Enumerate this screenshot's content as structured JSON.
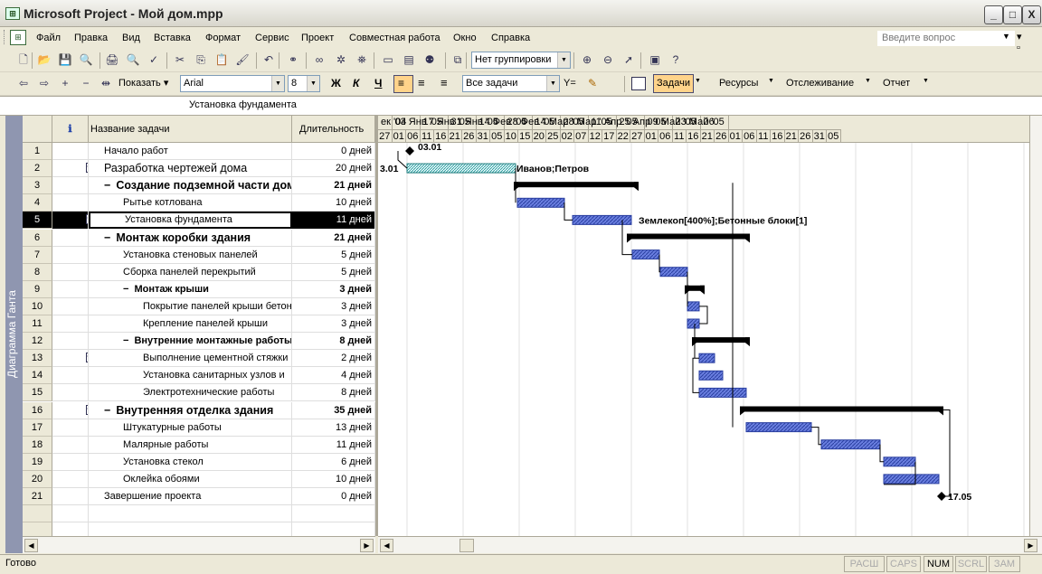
{
  "window": {
    "title": "Microsoft Project - Мой дом.mpp",
    "app_icon": "project-icon",
    "min_label": "_",
    "max_label": "□",
    "close_label": "X"
  },
  "menubar": {
    "items": [
      "Файл",
      "Правка",
      "Вид",
      "Вставка",
      "Формат",
      "Сервис",
      "Проект",
      "Совместная работа",
      "Окно",
      "Справка"
    ],
    "help_placeholder": "Введите вопрос",
    "doc_controls": "▾ ▫ ×"
  },
  "toolbar_standard": {
    "grouping_value": "Нет группировки"
  },
  "toolbar_formatting": {
    "show_label": "Показать",
    "font_value": "Arial",
    "size_value": "8",
    "bold_label": "Ж",
    "italic_label": "К",
    "underline_label": "Ч",
    "filter_value": "Все задачи",
    "tasks_label": "Задачи",
    "resources_label": "Ресурсы",
    "tracking_label": "Отслеживание",
    "report_label": "Отчет"
  },
  "entry_bar": {
    "value": "Установка фундамента"
  },
  "view_bar": {
    "label": "Диаграмма Ганта"
  },
  "table": {
    "headers": {
      "info": "ℹ",
      "name": "Название задачи",
      "duration": "Длительность"
    },
    "rows": [
      {
        "id": "1",
        "name": "Начало работ",
        "duration": "0 дней",
        "level": 0,
        "summary": false,
        "indicator": false
      },
      {
        "id": "2",
        "name": "Разработка чертежей дома",
        "duration": "20 дней",
        "level": 0,
        "summary": false,
        "indicator": true,
        "big": true
      },
      {
        "id": "3",
        "name": "Создание подземной части дом",
        "duration": "21 дней",
        "level": 0,
        "summary": true,
        "indicator": false
      },
      {
        "id": "4",
        "name": "Рытье котлована",
        "duration": "10 дней",
        "level": 1,
        "summary": false,
        "indicator": false
      },
      {
        "id": "5",
        "name": "Установка фундамента",
        "duration": "11 дней",
        "level": 1,
        "summary": false,
        "indicator": true,
        "selected": true
      },
      {
        "id": "6",
        "name": "Монтаж коробки здания",
        "duration": "21 дней",
        "level": 0,
        "summary": true,
        "indicator": false
      },
      {
        "id": "7",
        "name": "Установка стеновых панелей",
        "duration": "5 дней",
        "level": 1,
        "summary": false,
        "indicator": false
      },
      {
        "id": "8",
        "name": "Сборка панелей перекрытий",
        "duration": "5 дней",
        "level": 1,
        "summary": false,
        "indicator": false
      },
      {
        "id": "9",
        "name": "Монтаж крыши",
        "duration": "3 дней",
        "level": 1,
        "summary": true,
        "indicator": false
      },
      {
        "id": "10",
        "name": "Покрытие панелей крыши бетон",
        "duration": "3 дней",
        "level": 2,
        "summary": false,
        "indicator": false
      },
      {
        "id": "11",
        "name": "Крепление панелей крыши",
        "duration": "3 дней",
        "level": 2,
        "summary": false,
        "indicator": false
      },
      {
        "id": "12",
        "name": "Внутренние монтажные работы",
        "duration": "8 дней",
        "level": 1,
        "summary": true,
        "indicator": false
      },
      {
        "id": "13",
        "name": "Выполнение цементной стяжки",
        "duration": "2 дней",
        "level": 2,
        "summary": false,
        "indicator": true
      },
      {
        "id": "14",
        "name": "Установка санитарных узлов и",
        "duration": "4 дней",
        "level": 2,
        "summary": false,
        "indicator": false
      },
      {
        "id": "15",
        "name": "Электротехнические работы",
        "duration": "8 дней",
        "level": 2,
        "summary": false,
        "indicator": false
      },
      {
        "id": "16",
        "name": "Внутренняя отделка здания",
        "duration": "35 дней",
        "level": 0,
        "summary": true,
        "indicator": true
      },
      {
        "id": "17",
        "name": "Штукатурные работы",
        "duration": "13 дней",
        "level": 1,
        "summary": false,
        "indicator": false
      },
      {
        "id": "18",
        "name": "Малярные работы",
        "duration": "11 дней",
        "level": 1,
        "summary": false,
        "indicator": false
      },
      {
        "id": "19",
        "name": "Установка стекол",
        "duration": "6 дней",
        "level": 1,
        "summary": false,
        "indicator": false
      },
      {
        "id": "20",
        "name": "Оклейка обоями",
        "duration": "10 дней",
        "level": 1,
        "summary": false,
        "indicator": false
      },
      {
        "id": "21",
        "name": "Завершение проекта",
        "duration": "0 дней",
        "level": 0,
        "summary": false,
        "indicator": false
      }
    ]
  },
  "gantt": {
    "weeks": [
      "ек '04",
      "03 Янв '05",
      "17 Янв '05",
      "31 Янв '05",
      "14 Фев '05",
      "28 Фев '05",
      "14 Мар '05",
      "28 Мар '05",
      "11 Апр '05",
      "25 Апр '05",
      "09 Май '05",
      "23 Май '05",
      "06"
    ],
    "days": [
      "27",
      "01",
      "06",
      "11",
      "16",
      "21",
      "26",
      "31",
      "05",
      "10",
      "15",
      "20",
      "25",
      "02",
      "07",
      "12",
      "17",
      "22",
      "27",
      "01",
      "06",
      "11",
      "16",
      "21",
      "26",
      "01",
      "06",
      "11",
      "16",
      "21",
      "26",
      "31",
      "05"
    ],
    "labels": {
      "start_milestone": "03.01",
      "row2_left": "3.01",
      "row2_resources": "Иванов;Петров",
      "row5_resources": "Землекоп[400%];Бетонные блоки[1]",
      "end_milestone": "17.05"
    }
  },
  "status": {
    "text": "Готово",
    "indicators": [
      {
        "label": "РАСШ",
        "on": false
      },
      {
        "label": "CAPS",
        "on": false
      },
      {
        "label": "NUM",
        "on": true
      },
      {
        "label": "SCRL",
        "on": false
      },
      {
        "label": "ЗАМ",
        "on": false
      }
    ]
  },
  "colors": {
    "task_bar": "#4a55c8",
    "summary_bar": "#000000",
    "selection": "#000000",
    "view_bar": "#8f96b0"
  }
}
